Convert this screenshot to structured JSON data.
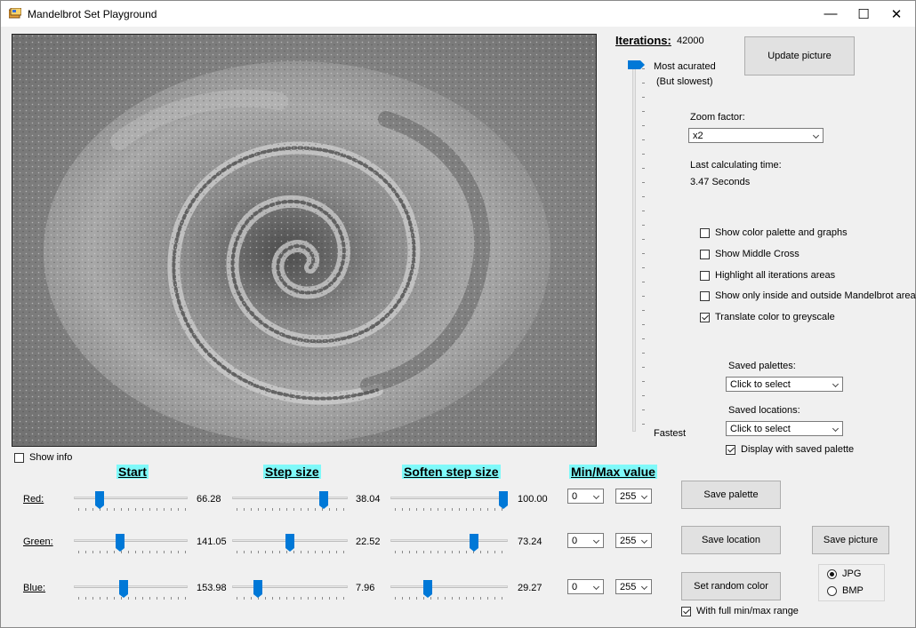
{
  "window": {
    "title": "Mandelbrot Set Playground",
    "minimize": "—",
    "maximize": "☐",
    "close": "✕"
  },
  "iterations": {
    "label": "Iterations:",
    "value": "42000",
    "top_label": "Most acurated",
    "top_sub": "(But slowest)",
    "bottom_label": "Fastest",
    "slider_level": 0
  },
  "update_button": "Update picture",
  "zoom": {
    "label": "Zoom factor:",
    "value": "x2"
  },
  "calc": {
    "label": "Last calculating time:",
    "value": "3.47 Seconds"
  },
  "options": [
    {
      "label": "Show color palette and graphs",
      "checked": false
    },
    {
      "label": "Show Middle Cross",
      "checked": false
    },
    {
      "label": "Highlight all iterations areas",
      "checked": false
    },
    {
      "label": "Show only inside and outside Mandelbrot areas",
      "checked": false
    },
    {
      "label": "Translate color to greyscale",
      "checked": true
    }
  ],
  "saved_palettes": {
    "label": "Saved palettes:",
    "value": "Click to select"
  },
  "saved_locations": {
    "label": "Saved locations:",
    "value": "Click to select"
  },
  "display_saved_palette": {
    "label": "Display with saved palette",
    "checked": true
  },
  "show_info": {
    "label": "Show info",
    "checked": false
  },
  "headings": {
    "start": "Start",
    "step": "Step size",
    "soften": "Soften step size",
    "minmax": "Min/Max value"
  },
  "channels": [
    {
      "label": "Red:",
      "start": {
        "value": "66.28",
        "fraction": 0.2
      },
      "step": {
        "value": "38.04",
        "fraction": 0.82
      },
      "soften": {
        "value": "100.00",
        "fraction": 1.0
      },
      "min": "0",
      "max": "255"
    },
    {
      "label": "Green:",
      "start": {
        "value": "141.05",
        "fraction": 0.4
      },
      "step": {
        "value": "22.52",
        "fraction": 0.5
      },
      "soften": {
        "value": "73.24",
        "fraction": 0.73
      },
      "min": "0",
      "max": "255"
    },
    {
      "label": "Blue:",
      "start": {
        "value": "153.98",
        "fraction": 0.43
      },
      "step": {
        "value": "7.96",
        "fraction": 0.2
      },
      "soften": {
        "value": "29.27",
        "fraction": 0.3
      },
      "min": "0",
      "max": "255"
    }
  ],
  "buttons": {
    "save_palette": "Save  palette",
    "save_location": "Save location",
    "save_picture": "Save picture",
    "random_color": "Set random color"
  },
  "full_range": {
    "label": "With full min/max range",
    "checked": true
  },
  "format": {
    "options": [
      "JPG",
      "BMP"
    ],
    "selected": "JPG"
  }
}
